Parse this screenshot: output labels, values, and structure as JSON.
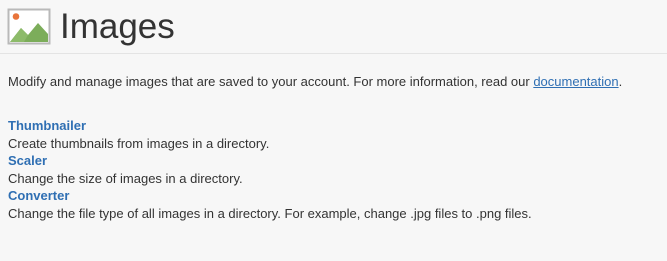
{
  "header": {
    "title": "Images",
    "icon": "image-icon"
  },
  "description": {
    "text": "Modify and manage images that are saved to your account. For more information, read our ",
    "link_label": "documentation",
    "suffix": "."
  },
  "tools": [
    {
      "label": "Thumbnailer",
      "description": "Create thumbnails from images in a directory."
    },
    {
      "label": "Scaler",
      "description": "Change the size of images in a directory."
    },
    {
      "label": "Converter",
      "description": "Change the file type of all images in a directory. For example, change .jpg files to .png files."
    }
  ],
  "colors": {
    "link": "#2f6fb3",
    "text": "#333333",
    "background": "#f7f7f7",
    "icon_green": "#7cad5a",
    "icon_sun": "#e8743b"
  }
}
